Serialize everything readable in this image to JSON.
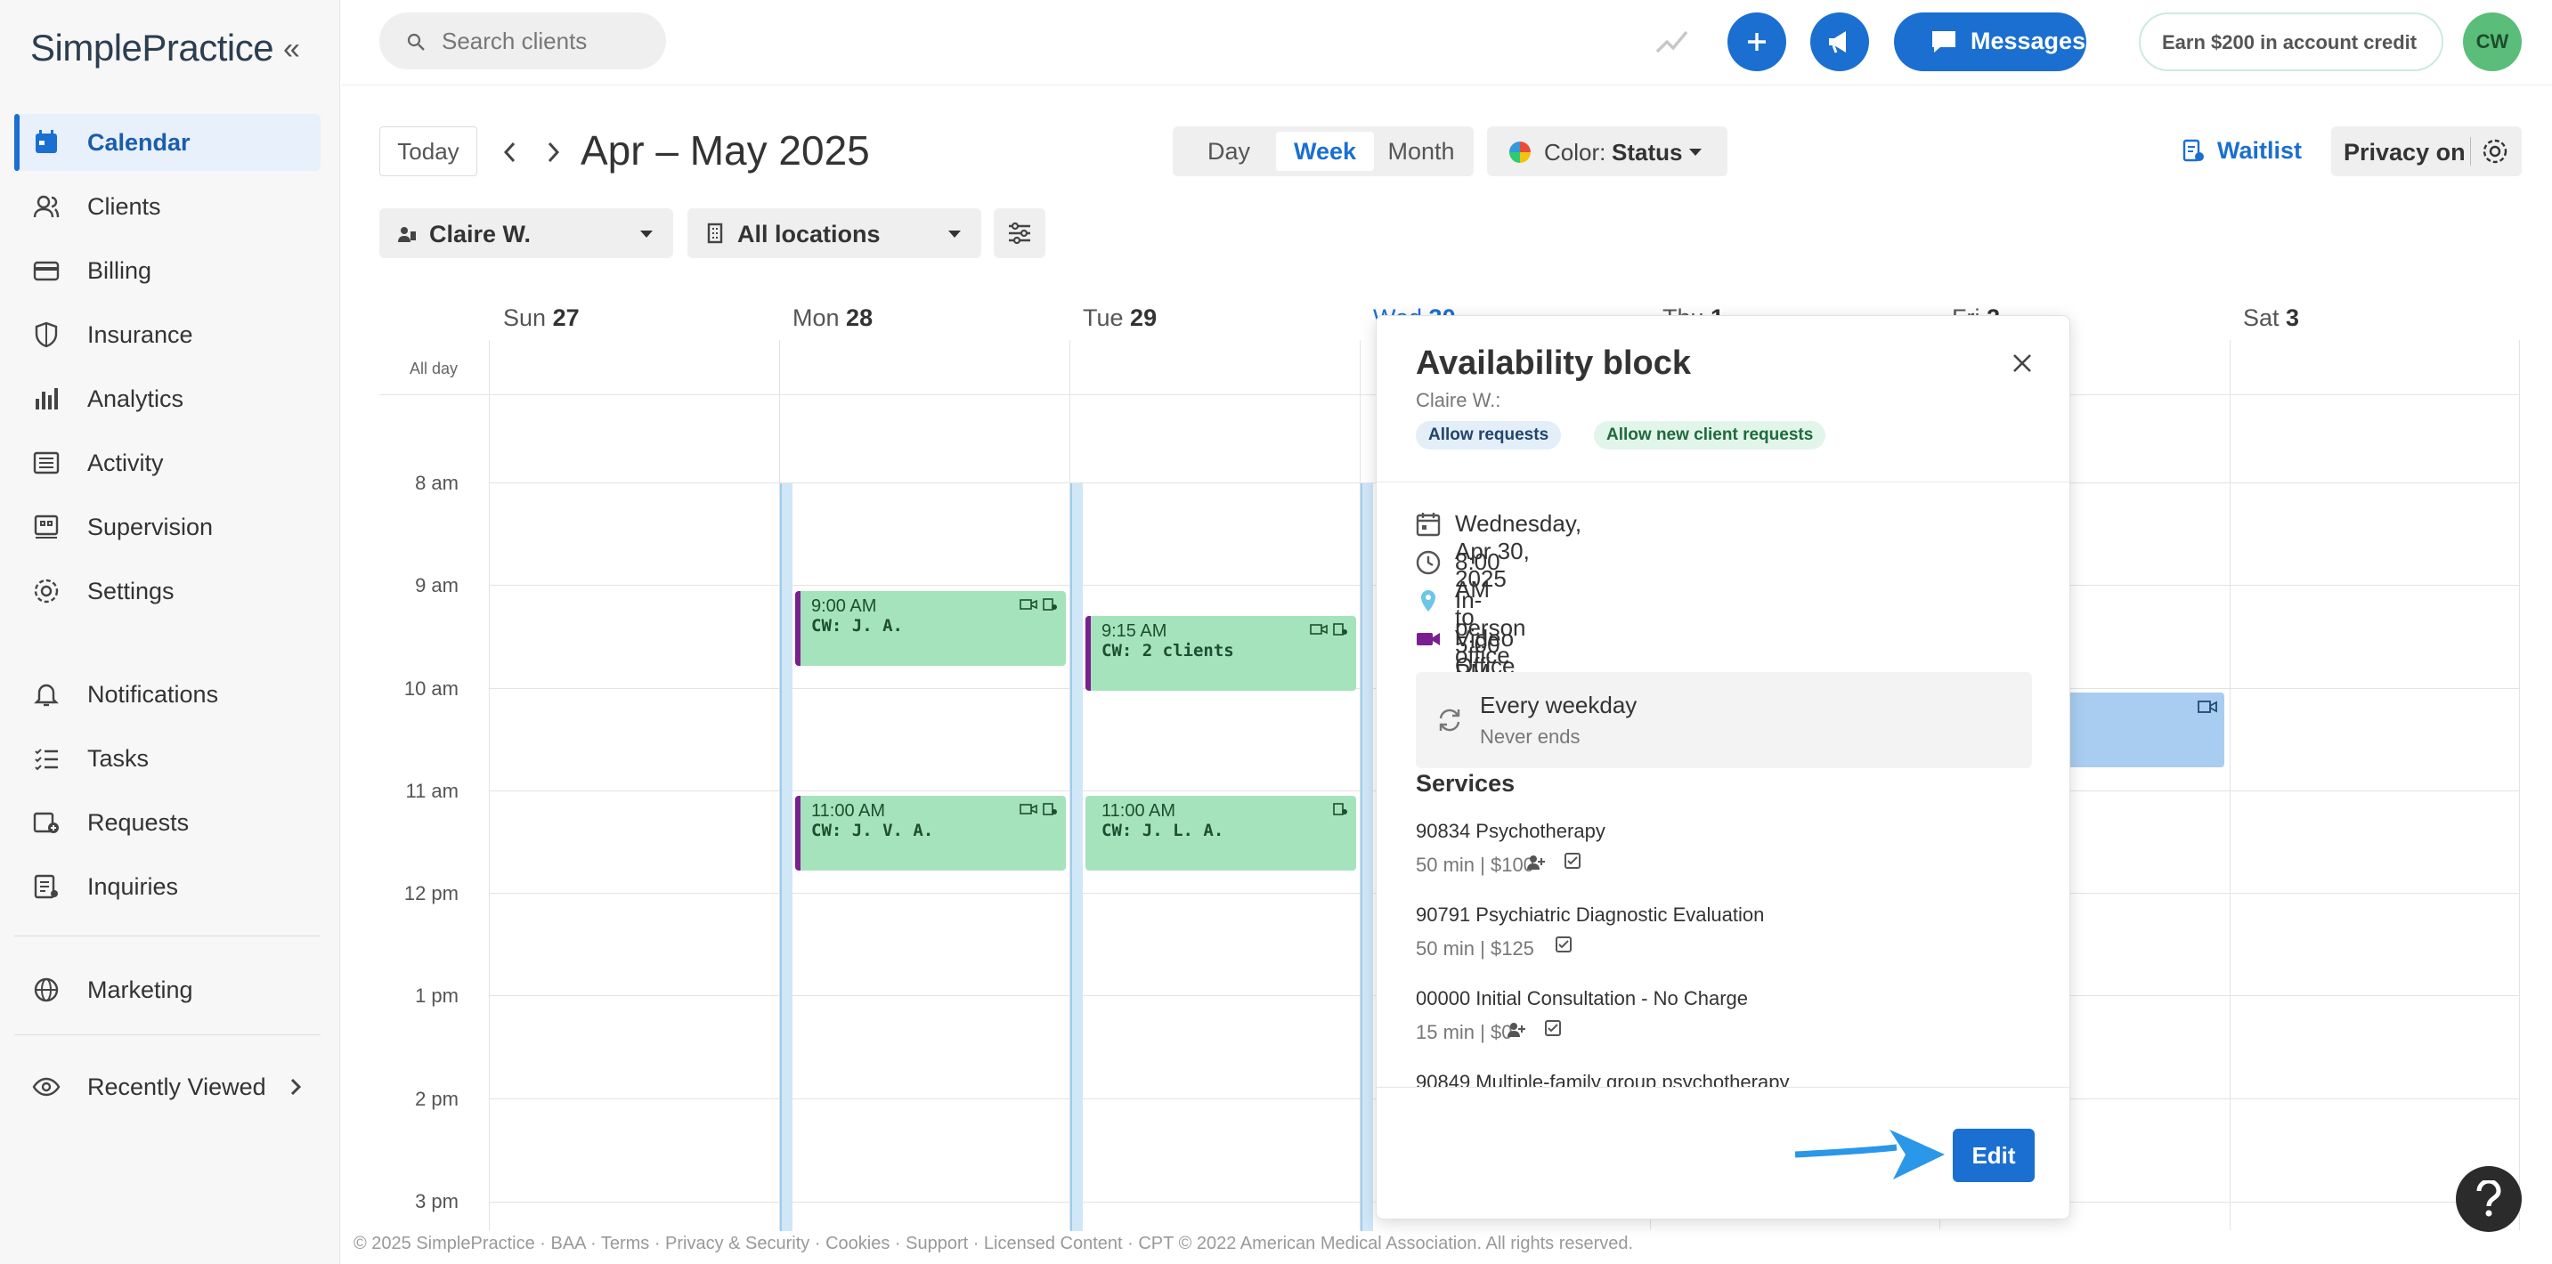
{
  "app": {
    "logo": "SimplePractice"
  },
  "sidebar": {
    "items": [
      {
        "label": "Calendar",
        "icon": "calendar-icon",
        "active": true
      },
      {
        "label": "Clients",
        "icon": "clients-icon"
      },
      {
        "label": "Billing",
        "icon": "billing-card-icon"
      },
      {
        "label": "Insurance",
        "icon": "shield-icon"
      },
      {
        "label": "Analytics",
        "icon": "bar-chart-icon"
      },
      {
        "label": "Activity",
        "icon": "list-icon"
      },
      {
        "label": "Supervision",
        "icon": "supervision-icon"
      },
      {
        "label": "Settings",
        "icon": "gear-icon"
      },
      {
        "label": "Notifications",
        "icon": "bell-icon"
      },
      {
        "label": "Tasks",
        "icon": "tasks-icon"
      },
      {
        "label": "Requests",
        "icon": "requests-icon"
      },
      {
        "label": "Inquiries",
        "icon": "inquiries-icon"
      },
      {
        "label": "Marketing",
        "icon": "globe-icon"
      },
      {
        "label": "Recently Viewed",
        "icon": "eye-icon"
      }
    ]
  },
  "topbar": {
    "search_placeholder": "Search clients",
    "messages_label": "Messages",
    "earn_label": "Earn $200 in account credit",
    "avatar_initials": "CW"
  },
  "calendar": {
    "today_label": "Today",
    "range_title": "Apr – May 2025",
    "views": [
      "Day",
      "Week",
      "Month"
    ],
    "active_view": "Week",
    "color_prefix": "Color:",
    "color_value": "Status",
    "waitlist_label": "Waitlist",
    "privacy_label": "Privacy on",
    "clinician_filter": "Claire W.",
    "location_filter": "All locations",
    "all_day_label": "All day",
    "days": [
      {
        "name": "Sun",
        "num": "27"
      },
      {
        "name": "Mon",
        "num": "28"
      },
      {
        "name": "Tue",
        "num": "29"
      },
      {
        "name": "Wed",
        "num": "30"
      },
      {
        "name": "Thu",
        "num": "1"
      },
      {
        "name": "Fri",
        "num": "2"
      },
      {
        "name": "Sat",
        "num": "3"
      }
    ],
    "hours": [
      "8 am",
      "9 am",
      "10 am",
      "11 am",
      "12 pm",
      "1 pm",
      "2 pm",
      "3 pm"
    ],
    "events": [
      {
        "time": "9:00 AM",
        "title": "CW: J. A."
      },
      {
        "time": "9:15 AM",
        "title": "CW: 2 clients"
      },
      {
        "time": "11:00 AM",
        "title": "CW: J. V. A."
      },
      {
        "time": "11:00 AM",
        "title": "CW: J. L. A."
      }
    ]
  },
  "popup": {
    "title": "Availability block",
    "subtitle": "Claire W.:",
    "tags": [
      "Allow requests",
      "Allow new client requests"
    ],
    "date": "Wednesday, Apr 30, 2025",
    "time": "8:00 AM to 5:00 PM",
    "location": "In-person office",
    "video": "Video Office",
    "recurrence": "Every weekday",
    "recurrence_end": "Never ends",
    "services_heading": "Services",
    "services": [
      {
        "name": "90834 Psychotherapy",
        "meta": "50 min | $100"
      },
      {
        "name": "90791 Psychiatric Diagnostic Evaluation",
        "meta": "50 min | $125"
      },
      {
        "name": "00000 Initial Consultation - No Charge",
        "meta": "15 min | $0"
      },
      {
        "name": "90849 Multiple-family group psychotherapy",
        "meta": ""
      }
    ],
    "edit_label": "Edit"
  },
  "footer": {
    "text": "© 2025 SimplePractice · BAA · Terms · Privacy & Security · Cookies · Support · Licensed Content · CPT © 2022 American Medical Association. All rights reserved."
  },
  "colors": {
    "accent": "#1a6fd1",
    "event_green": "#a5e3bd",
    "availability": "#cfe7f7"
  }
}
